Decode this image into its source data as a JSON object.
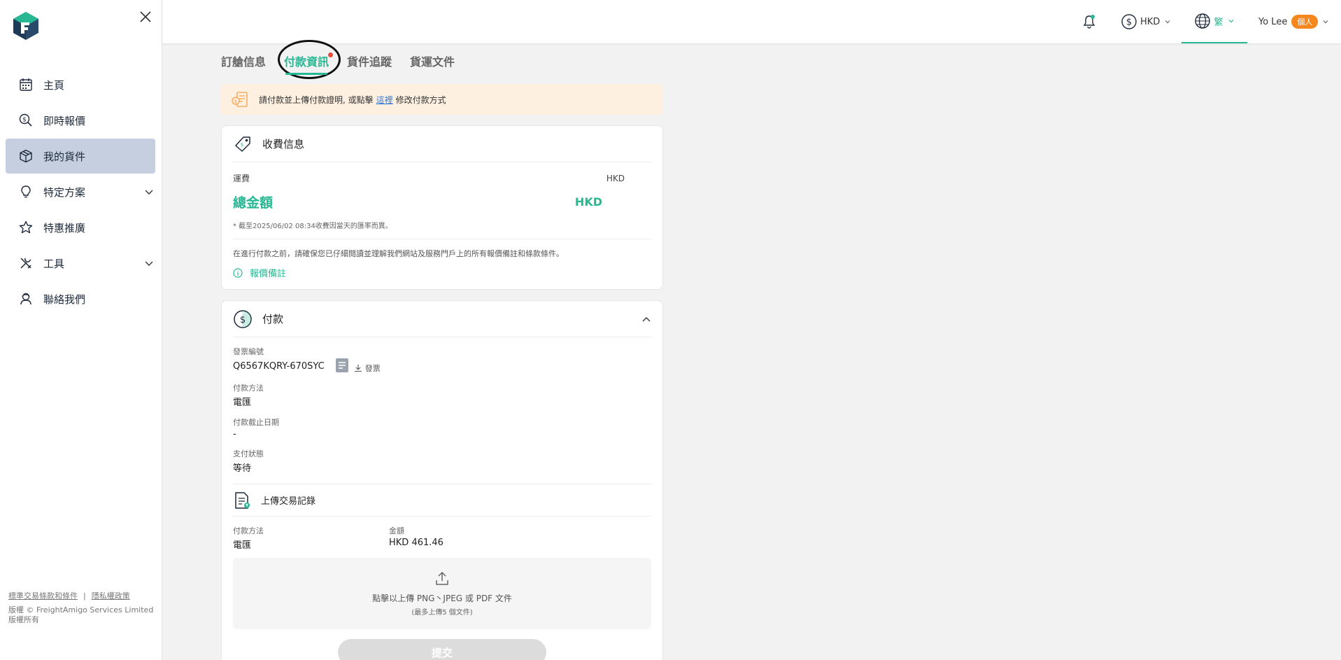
{
  "sidebar": {
    "items": [
      {
        "label": "主頁",
        "icon": "calendar-icon"
      },
      {
        "label": "即時報價",
        "icon": "quote-search-icon"
      },
      {
        "label": "我的貨件",
        "icon": "package-icon"
      },
      {
        "label": "特定方案",
        "icon": "lightbulb-icon"
      },
      {
        "label": "特惠推廣",
        "icon": "star-icon"
      },
      {
        "label": "工具",
        "icon": "tools-icon"
      },
      {
        "label": "聯絡我們",
        "icon": "support-agent-icon"
      }
    ],
    "footer": {
      "terms": "標準交易條款和條件",
      "separator": "|",
      "privacy": "隱私權政策",
      "copyright": "版權 © FreightAmigo Services Limited",
      "rights": "版權所有"
    }
  },
  "topbar": {
    "currency": "HKD",
    "language": "繁",
    "user_name": "Yo Lee",
    "user_badge": "個人"
  },
  "tabs": [
    "訂艙信息",
    "付款資訊",
    "貨件追蹤",
    "貨運文件"
  ],
  "notice": {
    "before": "請付款並上傳付款證明, 或點擊",
    "link": "這裡",
    "after": "修改付款方式"
  },
  "charges": {
    "title": "收費信息",
    "freight_label": "運費",
    "freight_currency": "HKD",
    "total_label": "總金額",
    "total_currency": "HKD",
    "rate_note": "* 截至2025/06/02 08:34收費因當天的匯率而異。",
    "terms_note": "在進行付款之前，請確保您已仔細閱讀並理解我們網站及服務門戶上的所有報價備註和條款條件。",
    "remark_link": "報價備註"
  },
  "payment": {
    "title": "付款",
    "invoice_label": "發票編號",
    "invoice_no": "Q6567KQRY-670SYC",
    "invoice_download": "發票",
    "method_label": "付款方法",
    "method_value": "電匯",
    "deadline_label": "付款截止日期",
    "deadline_value": "-",
    "status_label": "支付狀態",
    "status_value": "等待",
    "upload_title": "上傳交易記錄",
    "rec_method_label": "付款方法",
    "rec_method_value": "電匯",
    "amount_label": "金額",
    "amount_value": "HKD 461.46",
    "drop_text": "點擊以上傳 PNG丶JPEG 或 PDF 文件",
    "drop_limit": "(最多上傳5 個文件)",
    "submit_label": "提交"
  },
  "colors": {
    "accent": "#27b893",
    "sidebar_active": "#c5cfdf",
    "notice_bg": "#fdf0e0",
    "badge": "#f5871f",
    "alert_dot": "#e84c3d"
  }
}
